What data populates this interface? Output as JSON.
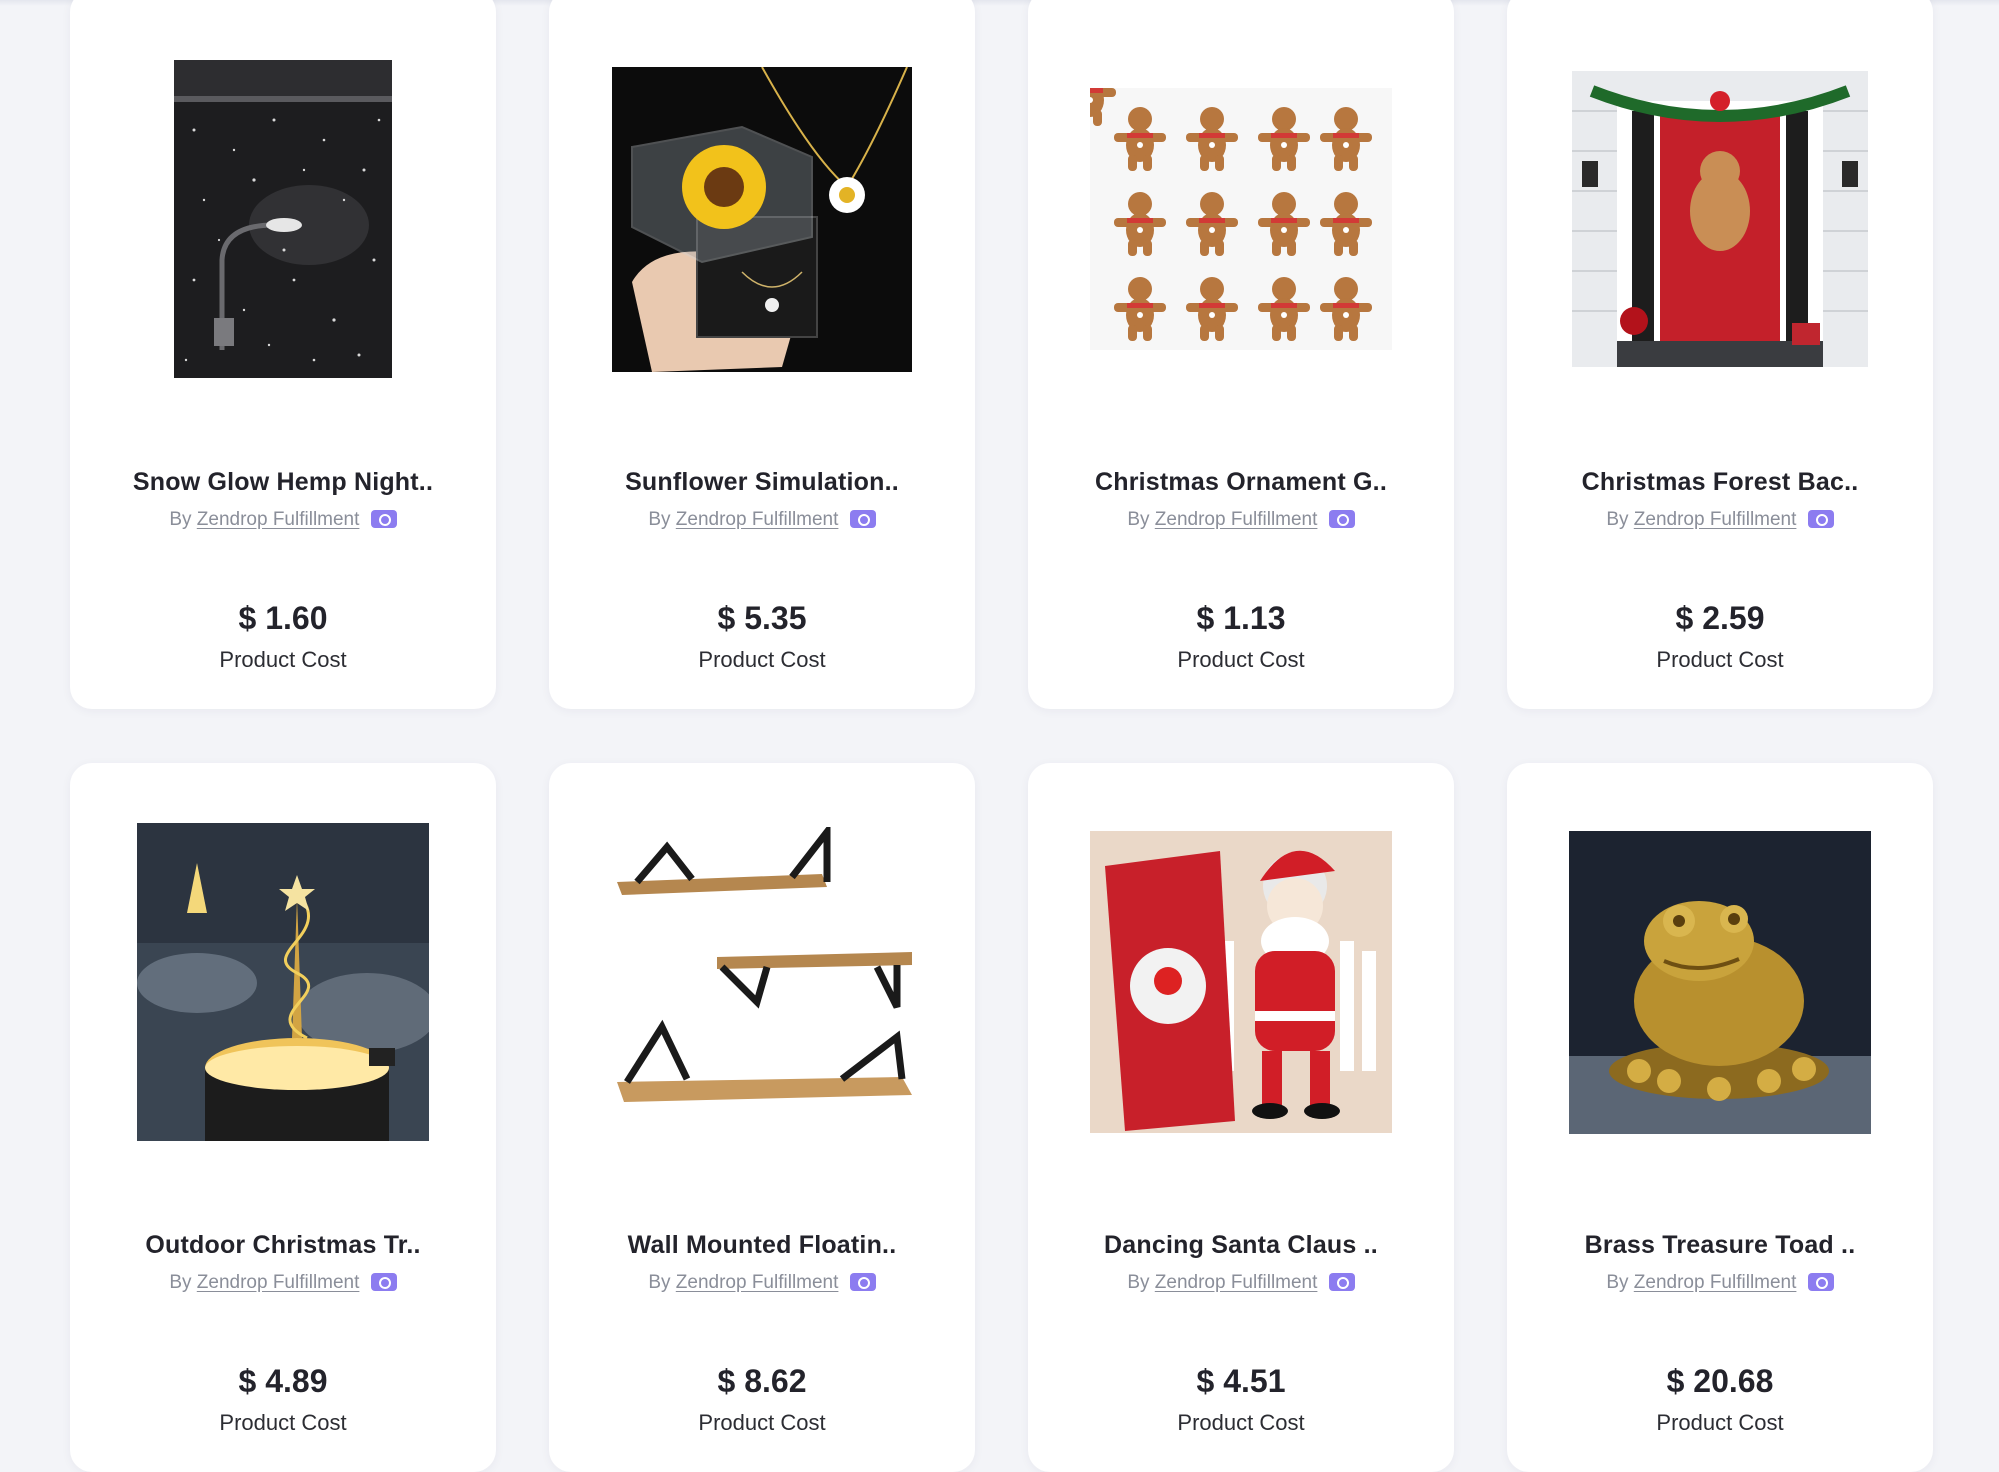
{
  "products": [
    {
      "title": "Snow Glow Hemp Night..",
      "by": "By",
      "seller": "Zendrop Fulfillment",
      "price": "$ 1.60",
      "cost_label": "Product Cost",
      "image": "snowy-streetlight-photo"
    },
    {
      "title": "Sunflower Simulation..",
      "by": "By",
      "seller": "Zendrop Fulfillment",
      "price": "$ 5.35",
      "cost_label": "Product Cost",
      "image": "sunflower-box-necklace-photo"
    },
    {
      "title": "Christmas Ornament G..",
      "by": "By",
      "seller": "Zendrop Fulfillment",
      "price": "$ 1.13",
      "cost_label": "Product Cost",
      "image": "gingerbread-ornaments-photo"
    },
    {
      "title": "Christmas Forest Bac..",
      "by": "By",
      "seller": "Zendrop Fulfillment",
      "price": "$ 2.59",
      "cost_label": "Product Cost",
      "image": "christmas-door-cover-photo"
    },
    {
      "title": "Outdoor Christmas Tr..",
      "by": "By",
      "seller": "Zendrop Fulfillment",
      "price": "$ 4.89",
      "cost_label": "Product Cost",
      "image": "outdoor-light-tree-photo"
    },
    {
      "title": "Wall Mounted Floatin..",
      "by": "By",
      "seller": "Zendrop Fulfillment",
      "price": "$ 8.62",
      "cost_label": "Product Cost",
      "image": "floating-shelves-photo"
    },
    {
      "title": "Dancing Santa Claus ..",
      "by": "By",
      "seller": "Zendrop Fulfillment",
      "price": "$ 4.51",
      "cost_label": "Product Cost",
      "image": "dancing-santa-toy-photo"
    },
    {
      "title": "Brass Treasure Toad ..",
      "by": "By",
      "seller": "Zendrop Fulfillment",
      "price": "$ 20.68",
      "cost_label": "Product Cost",
      "image": "brass-toad-figurine-photo"
    }
  ],
  "colors": {
    "page_background": "#f3f4f8",
    "card_background": "#ffffff",
    "badge": "#8c7cf0",
    "text_primary": "#23232b",
    "text_muted": "#8a8e99"
  }
}
